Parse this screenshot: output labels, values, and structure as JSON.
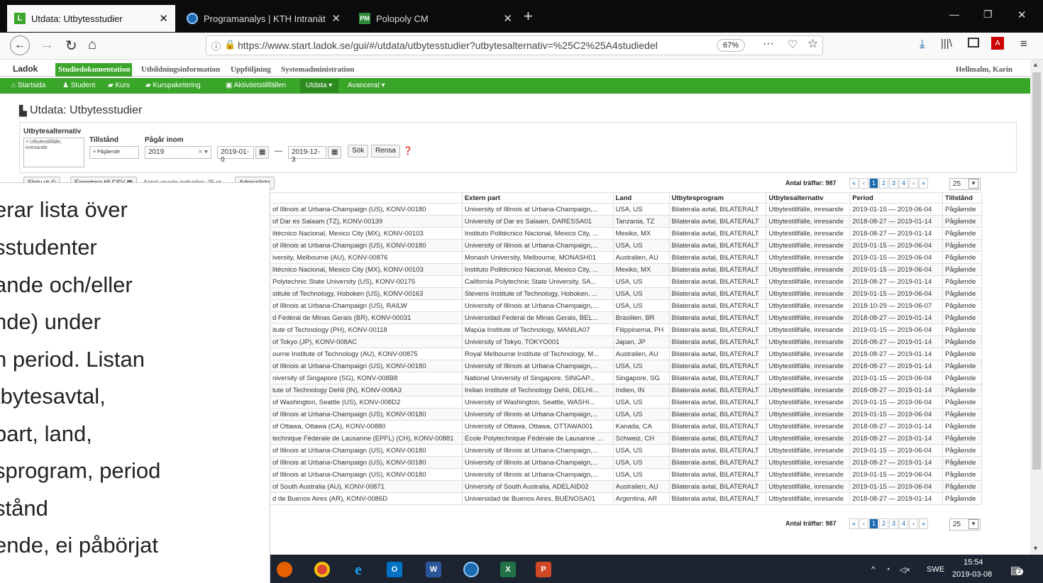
{
  "browser": {
    "tabs": [
      {
        "title": "Utdata: Utbytesstudier",
        "favicon": "L",
        "active": true
      },
      {
        "title": "Programanalys | KTH Intranät",
        "favicon": "kth-icon",
        "active": false
      },
      {
        "title": "Polopoly CM",
        "favicon": "PM",
        "active": false
      }
    ],
    "new_tab": "+",
    "url": "https://www.start.ladok.se/gui/#/utdata/utbytesstudier?utbytesalternativ=%25C2%25A4studiedel",
    "zoom": "67%",
    "more": "···"
  },
  "ladok": {
    "logo": "Ladok",
    "menu": [
      "Studiedokumentation",
      "Utbildningsinformation",
      "Uppföljning",
      "Systemadministration"
    ],
    "user": "Hellmalm, Karin",
    "nav": [
      "Startsida",
      "Student",
      "Kurs",
      "Kurspaketering",
      "Aktivitetstillfällen",
      "Utdata",
      "Avancerat"
    ],
    "page_title": "Utdata: Utbytesstudier"
  },
  "filters": {
    "utbytesalternativ_label": "Utbytesalternativ",
    "utbytesalternativ_value": "Utbytestillfälle, inresande",
    "tillstand_label": "Tillstånd",
    "tillstand_value": "Pågående",
    "pagar_label": "Pågår inom",
    "year": "2019",
    "from": "2019-01-0",
    "dash": "—",
    "to": "2019-12-3",
    "search": "Sök",
    "clear": "Rensa"
  },
  "toolbar": {
    "print": "Skriv ut",
    "export": "Exportera till CSV",
    "count_text": "Antal visade individer: 25 st",
    "addresslist": "Adresslista"
  },
  "pagination": {
    "label": "Antal träffar: 987",
    "first": "«",
    "prev": "‹",
    "pages": [
      "1",
      "2",
      "3",
      "4"
    ],
    "next": "›",
    "last": "»",
    "page_size": "25"
  },
  "table": {
    "headers": [
      "",
      "Extern part",
      "Land",
      "Utbytesprogram",
      "Utbytesalternativ",
      "Period",
      "Tillstånd"
    ],
    "rows": [
      [
        "of Illinois at Urbana-Champaign (US), KONV-00180",
        "University of Illinois at Urbana-Champaign,...",
        "USA, US",
        "Bilaterala avtal, BILATERALT",
        "Utbytestillfälle, inresande",
        "2019-01-15 — 2019-06-04",
        "Pågående"
      ],
      [
        "of Dar es Salaam (TZ), KONV-00139",
        "University of Dar es Salaam, DARESSA01",
        "Tanzania, TZ",
        "Bilaterala avtal, BILATERALT",
        "Utbytestillfälle, inresande",
        "2018-08-27 — 2019-01-14",
        "Pågående"
      ],
      [
        "litécnico Nacional, Mexico City (MX), KONV-00103",
        "Instituto Politécnico Nacional, Mexico City, ...",
        "Mexiko, MX",
        "Bilaterala avtal, BILATERALT",
        "Utbytestillfälle, inresande",
        "2018-08-27 — 2019-01-14",
        "Pågående"
      ],
      [
        "of Illinois at Urbana-Champaign (US), KONV-00180",
        "University of Illinois at Urbana-Champaign,...",
        "USA, US",
        "Bilaterala avtal, BILATERALT",
        "Utbytestillfälle, inresande",
        "2019-01-15 — 2019-06-04",
        "Pågående"
      ],
      [
        "iversity, Melbourne (AU), KONV-00876",
        "Monash University, Melbourne, MONASH01",
        "Australien, AU",
        "Bilaterala avtal, BILATERALT",
        "Utbytestillfälle, inresande",
        "2019-01-15 — 2019-06-04",
        "Pågående"
      ],
      [
        "litécnico Nacional, Mexico City (MX), KONV-00103",
        "Instituto Politécnico Nacional, Mexico City, ...",
        "Mexiko, MX",
        "Bilaterala avtal, BILATERALT",
        "Utbytestillfälle, inresande",
        "2019-01-15 — 2019-06-04",
        "Pågående"
      ],
      [
        "Polytechnic State University (US), KONV-00175",
        "California Polytechnic State University, SA...",
        "USA, US",
        "Bilaterala avtal, BILATERALT",
        "Utbytestillfälle, inresande",
        "2018-08-27 — 2019-01-14",
        "Pågående"
      ],
      [
        "stitute of Technology, Hoboken (US), KONV-00163",
        "Stevens Institute of Technology, Hoboken, ...",
        "USA, US",
        "Bilaterala avtal, BILATERALT",
        "Utbytestillfälle, inresande",
        "2019-01-15 — 2019-06-04",
        "Pågående"
      ],
      [
        "of Illinois at Urbana-Champaign (US), RAILW",
        "University of Illinois at Urbana-Champaign,...",
        "USA, US",
        "Bilaterala avtal, BILATERALT",
        "Utbytestillfälle, inresande",
        "2018-10-29 — 2019-06-07",
        "Pågående"
      ],
      [
        "d Federal de Minas Gerais (BR), KONV-00031",
        "Universidad Federal de Minas Gerais, BEL...",
        "Brasilien, BR",
        "Bilaterala avtal, BILATERALT",
        "Utbytestillfälle, inresande",
        "2018-08-27 — 2019-01-14",
        "Pågående"
      ],
      [
        "itute of Technology (PH), KONV-00118",
        "Mapúa Institute of Technology, MANILA07",
        "Filippinerna, PH",
        "Bilaterala avtal, BILATERALT",
        "Utbytestillfälle, inresande",
        "2019-01-15 — 2019-06-04",
        "Pågående"
      ],
      [
        "of Tokyo (JP), KONV-008AC",
        "University of Tokyo, TOKYO001",
        "Japan, JP",
        "Bilaterala avtal, BILATERALT",
        "Utbytestillfälle, inresande",
        "2018-08-27 — 2019-01-14",
        "Pågående"
      ],
      [
        "ourne Institute of Technology (AU), KONV-00875",
        "Royal Melbourne Institute of Technology, M...",
        "Australien, AU",
        "Bilaterala avtal, BILATERALT",
        "Utbytestillfälle, inresande",
        "2018-08-27 — 2019-01-14",
        "Pågående"
      ],
      [
        "of Illinois at Urbana-Champaign (US), KONV-00180",
        "University of Illinois at Urbana-Champaign,...",
        "USA, US",
        "Bilaterala avtal, BILATERALT",
        "Utbytestillfälle, inresande",
        "2018-08-27 — 2019-01-14",
        "Pågående"
      ],
      [
        "niversity of Singapore (SG), KONV-008B8",
        "National University of Singapore, SINGAP...",
        "Singapore, SG",
        "Bilaterala avtal, BILATERALT",
        "Utbytestillfälle, inresande",
        "2019-01-15 — 2019-06-04",
        "Pågående"
      ],
      [
        "tute of Technology Dehli (IN), KONV-008A3",
        "Indian Institute of Technology Dehli, DELHI...",
        "Indien, IN",
        "Bilaterala avtal, BILATERALT",
        "Utbytestillfälle, inresande",
        "2018-08-27 — 2019-01-14",
        "Pågående"
      ],
      [
        "of Washington, Seattle (US), KONV-008D2",
        "University of Washington, Seattle, WASHI...",
        "USA, US",
        "Bilaterala avtal, BILATERALT",
        "Utbytestillfälle, inresande",
        "2019-01-15 — 2019-06-04",
        "Pågående"
      ],
      [
        "of Illinois at Urbana-Champaign (US), KONV-00180",
        "University of Illinois at Urbana-Champaign,...",
        "USA, US",
        "Bilaterala avtal, BILATERALT",
        "Utbytestillfälle, inresande",
        "2019-01-15 — 2019-06-04",
        "Pågående"
      ],
      [
        "of Ottawa, Ottawa (CA), KONV-00880",
        "University of Ottawa, Ottawa, OTTAWA001",
        "Kanada, CA",
        "Bilaterala avtal, BILATERALT",
        "Utbytestillfälle, inresande",
        "2018-08-27 — 2019-01-14",
        "Pågående"
      ],
      [
        "technique Fédérale de Lausanne (EPFL) (CH), KONV-00881",
        "École Polytechnique Fédérale de Lausanne ...",
        "Schweiz, CH",
        "Bilaterala avtal, BILATERALT",
        "Utbytestillfälle, inresande",
        "2018-08-27 — 2019-01-14",
        "Pågående"
      ],
      [
        "of Illinois at Urbana-Champaign (US), KONV-00180",
        "University of Illinois at Urbana-Champaign,...",
        "USA, US",
        "Bilaterala avtal, BILATERALT",
        "Utbytestillfälle, inresande",
        "2019-01-15 — 2019-06-04",
        "Pågående"
      ],
      [
        "of Illinois at Urbana-Champaign (US), KONV-00180",
        "University of Illinois at Urbana-Champaign,...",
        "USA, US",
        "Bilaterala avtal, BILATERALT",
        "Utbytestillfälle, inresande",
        "2018-08-27 — 2019-01-14",
        "Pågående"
      ],
      [
        "of Illinois at Urbana-Champaign (US), KONV-00180",
        "University of Illinois at Urbana-Champaign,...",
        "USA, US",
        "Bilaterala avtal, BILATERALT",
        "Utbytestillfälle, inresande",
        "2019-01-15 — 2019-06-04",
        "Pågående"
      ],
      [
        "of South Australia (AU), KONV-00871",
        "University of South Australia, ADELAID02",
        "Australien, AU",
        "Bilaterala avtal, BILATERALT",
        "Utbytestillfälle, inresande",
        "2019-01-15 — 2019-06-04",
        "Pågående"
      ],
      [
        "d de Buenos Aires (AR), KONV-0086D",
        "Universidad de Buenos Aires, BUENOSA01",
        "Argentina, AR",
        "Bilaterala avtal, BILATERALT",
        "Utbytestillfälle, inresande",
        "2018-08-27 — 2019-01-14",
        "Pågående"
      ]
    ]
  },
  "overlay_lines": [
    "erar lista över",
    "sstudenter",
    "ande och/eller",
    "nde) under",
    "n period. Listan",
    "tbytesavtal,",
    " part, land,",
    "sprogram, period",
    "stånd",
    "ende, ei påbörjat"
  ],
  "taskbar": {
    "lang": "SWE",
    "time": "15:54",
    "date": "2019-03-08",
    "notif_count": "2"
  },
  "colors": {
    "ladok_green": "#3aa629",
    "link_blue": "#1b6ab2",
    "taskbar": "#1c2431"
  }
}
